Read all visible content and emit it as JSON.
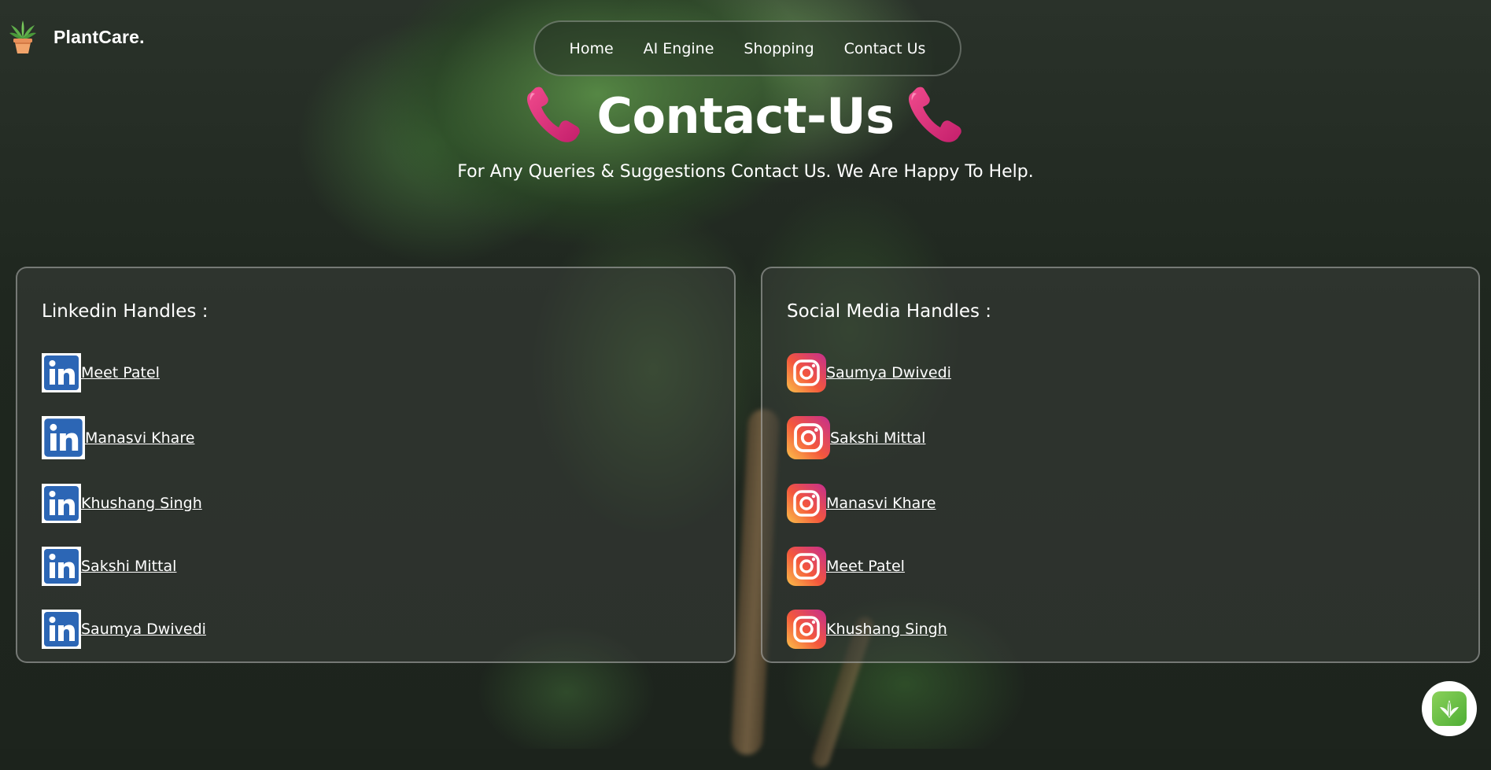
{
  "brand": {
    "name": "PlantCare.",
    "icon": "potted-plant-icon"
  },
  "nav": {
    "items": [
      {
        "label": "Home"
      },
      {
        "label": "AI Engine"
      },
      {
        "label": "Shopping"
      },
      {
        "label": "Contact Us"
      }
    ]
  },
  "hero": {
    "title": "Contact-Us",
    "icon": "phone-receiver-icon",
    "subtitle": "For Any Queries & Suggestions Contact Us. We Are Happy To Help."
  },
  "linkedin": {
    "heading": "Linkedin Handles :",
    "icon": "linkedin-icon",
    "items": [
      {
        "name": " Meet Patel"
      },
      {
        "name": " Manasvi Khare"
      },
      {
        "name": "Khushang Singh"
      },
      {
        "name": " Sakshi Mittal"
      },
      {
        "name": "Saumya Dwivedi"
      }
    ]
  },
  "social": {
    "heading": "Social Media Handles :",
    "icon": "instagram-icon",
    "items": [
      {
        "name": "Saumya Dwivedi"
      },
      {
        "name": "Sakshi Mittal"
      },
      {
        "name": "Manasvi Khare"
      },
      {
        "name": "Meet Patel"
      },
      {
        "name": "Khushang Singh"
      }
    ]
  },
  "fab": {
    "icon": "leaf-icon"
  },
  "colors": {
    "linkedin_blue": "#2c66b5",
    "instagram_pink": "#d62e79",
    "instagram_orange": "#f79e3a",
    "phone_pink": "#e2327f",
    "leaf_green": "#5cb83c"
  }
}
